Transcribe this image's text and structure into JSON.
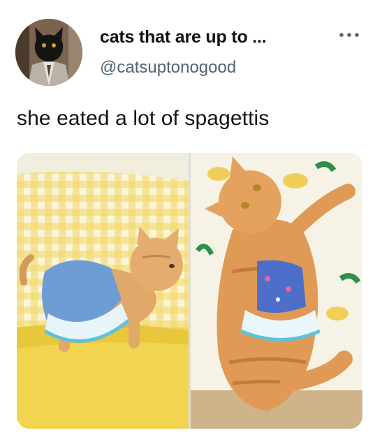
{
  "post": {
    "author_name": "cats that are up to ...",
    "author_handle": "@catsuptonogood",
    "text": "she eated a lot of spagettis"
  },
  "icons": {
    "more": "more-horizontal-icon",
    "avatar": "cat-avatar"
  },
  "media": {
    "count": 2,
    "images": [
      {
        "subject": "kitten-in-dress-standing"
      },
      {
        "subject": "cat-in-dress-lying"
      }
    ]
  },
  "colors": {
    "text_primary": "#0f1419",
    "text_secondary": "#536471",
    "background": "#ffffff"
  }
}
